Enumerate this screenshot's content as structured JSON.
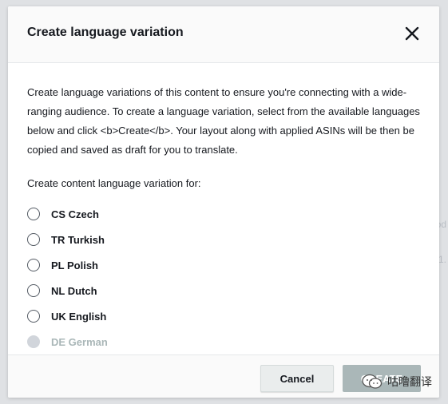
{
  "dialog": {
    "title": "Create language variation",
    "description": "Create language variations of this content to ensure you're connecting with a wide-ranging audience. To create a language variation, select from the available languages below and click <b>Create</b>. Your layout along with applied ASINs will be then be copied and saved as draft for you to translate.",
    "variation_label": "Create content language variation for:",
    "languages": [
      {
        "label": "CS Czech",
        "disabled": false
      },
      {
        "label": "TR Turkish",
        "disabled": false
      },
      {
        "label": "PL Polish",
        "disabled": false
      },
      {
        "label": "NL Dutch",
        "disabled": false
      },
      {
        "label": "UK English",
        "disabled": false
      },
      {
        "label": "DE German",
        "disabled": true
      }
    ],
    "cancel_label": "Cancel",
    "create_label": "CREATE"
  },
  "background": {
    "hint_1": "od",
    "hint_2": "1."
  },
  "watermark": {
    "text": "咕噜翻译"
  },
  "colors": {
    "text": "#16191f",
    "disabled": "#aab7b8",
    "create_button": "#aab7b8",
    "cancel_button": "#eaeded"
  }
}
